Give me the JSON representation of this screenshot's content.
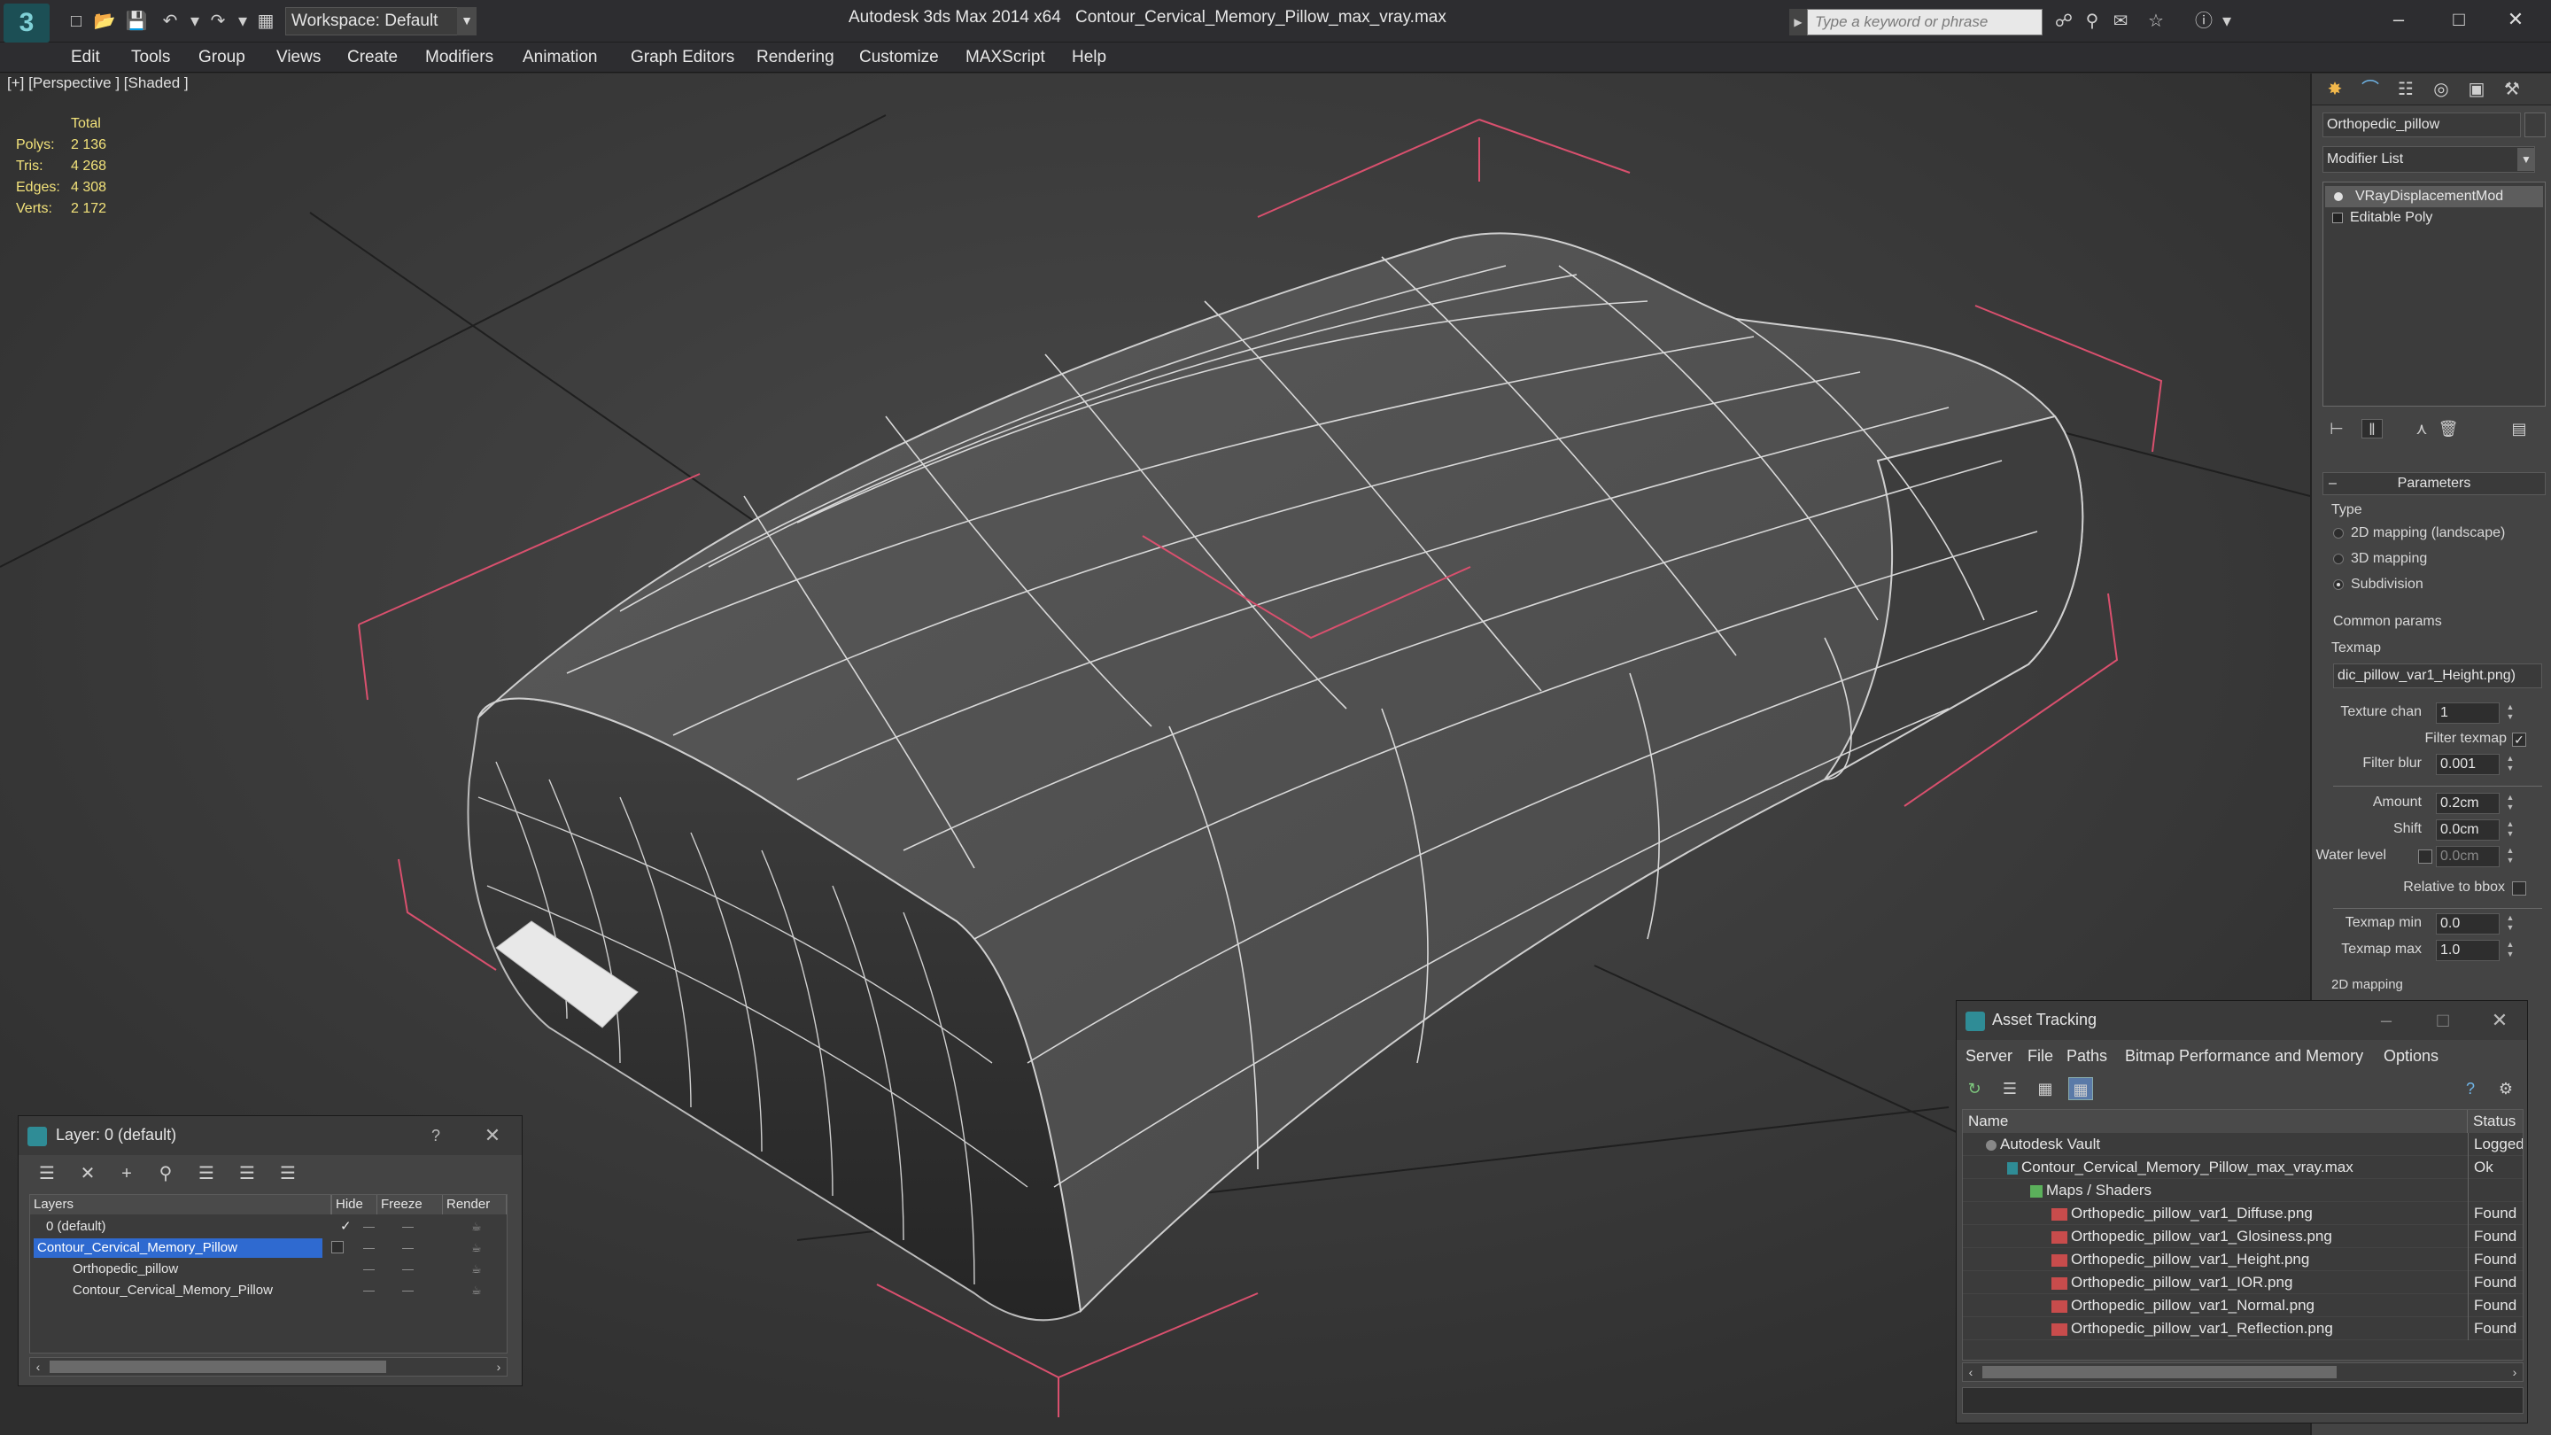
{
  "titlebar": {
    "workspace": "Workspace: Default",
    "app_title": "Autodesk 3ds Max  2014 x64",
    "file_title": "Contour_Cervical_Memory_Pillow_max_vray.max",
    "search_placeholder": "Type a keyword or phrase"
  },
  "menu": [
    "Edit",
    "Tools",
    "Group",
    "Views",
    "Create",
    "Modifiers",
    "Animation",
    "Graph Editors",
    "Rendering",
    "Customize",
    "MAXScript",
    "Help"
  ],
  "viewport": {
    "label": "[+] [Perspective ] [Shaded ]",
    "stats": {
      "header": "Total",
      "rows": [
        {
          "label": "Polys:",
          "value": "2 136"
        },
        {
          "label": "Tris:",
          "value": "4 268"
        },
        {
          "label": "Edges:",
          "value": "4 308"
        },
        {
          "label": "Verts:",
          "value": "2 172"
        }
      ]
    }
  },
  "command_panel": {
    "object_name": "Orthopedic_pillow",
    "modifier_list": "Modifier List",
    "stack": [
      "VRayDisplacementMod",
      "Editable Poly"
    ],
    "parameters": {
      "header": "Parameters",
      "type_label": "Type",
      "types": [
        "2D mapping (landscape)",
        "3D mapping",
        "Subdivision"
      ],
      "selected_type": 2,
      "common_label": "Common params",
      "texmap_label": "Texmap",
      "texmap_value": "dic_pillow_var1_Height.png)",
      "texture_chan_label": "Texture chan",
      "texture_chan": "1",
      "filter_texmap_label": "Filter texmap",
      "filter_blur_label": "Filter blur",
      "filter_blur": "0.001",
      "amount_label": "Amount",
      "amount": "0.2cm",
      "shift_label": "Shift",
      "shift": "0.0cm",
      "water_level_label": "Water level",
      "water_level": "0.0cm",
      "relative_bbox_label": "Relative to bbox",
      "texmap_min_label": "Texmap min",
      "texmap_min": "0.0",
      "texmap_max_label": "Texmap max",
      "texmap_max": "1.0",
      "mapping_2d_label": "2D mapping"
    }
  },
  "layer_dialog": {
    "title": "Layer: 0 (default)",
    "help": "?",
    "columns": [
      "Layers",
      "Hide",
      "Freeze",
      "Render"
    ],
    "rows": [
      {
        "name": "0 (default)",
        "indent": 1,
        "selected": false
      },
      {
        "name": "Contour_Cervical_Memory_Pillow",
        "indent": 1,
        "selected": true
      },
      {
        "name": "Orthopedic_pillow",
        "indent": 2,
        "selected": false
      },
      {
        "name": "Contour_Cervical_Memory_Pillow",
        "indent": 2,
        "selected": false
      }
    ]
  },
  "asset_dialog": {
    "title": "Asset Tracking",
    "menu": [
      "Server",
      "File",
      "Paths",
      "Bitmap Performance and Memory",
      "Options"
    ],
    "columns": [
      "Name",
      "Status"
    ],
    "rows": [
      {
        "name": "Autodesk Vault",
        "status": "Logged",
        "indent": 1,
        "icon": "vault"
      },
      {
        "name": "Contour_Cervical_Memory_Pillow_max_vray.max",
        "status": "Ok",
        "indent": 2,
        "icon": "max"
      },
      {
        "name": "Maps / Shaders",
        "status": "",
        "indent": 3,
        "icon": "maps"
      },
      {
        "name": "Orthopedic_pillow_var1_Diffuse.png",
        "status": "Found",
        "indent": 4,
        "icon": "png"
      },
      {
        "name": "Orthopedic_pillow_var1_Glosiness.png",
        "status": "Found",
        "indent": 4,
        "icon": "png"
      },
      {
        "name": "Orthopedic_pillow_var1_Height.png",
        "status": "Found",
        "indent": 4,
        "icon": "png"
      },
      {
        "name": "Orthopedic_pillow_var1_IOR.png",
        "status": "Found",
        "indent": 4,
        "icon": "png"
      },
      {
        "name": "Orthopedic_pillow_var1_Normal.png",
        "status": "Found",
        "indent": 4,
        "icon": "png"
      },
      {
        "name": "Orthopedic_pillow_var1_Reflection.png",
        "status": "Found",
        "indent": 4,
        "icon": "png"
      }
    ]
  },
  "colors": {
    "viewport_bg": "#3a3a3a",
    "panel_bg": "#444444",
    "selection": "#2f6ad0",
    "bbox_bracket": "#d9506e",
    "stats_text": "#f2e27a"
  }
}
